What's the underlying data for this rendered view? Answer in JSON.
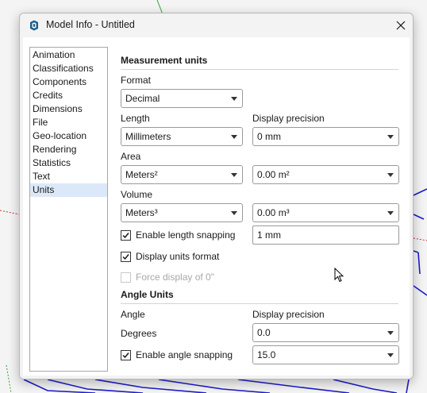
{
  "window": {
    "title": "Model Info - Untitled",
    "app_icon": "sketchup-icon",
    "close_icon": "close-icon"
  },
  "sidebar": {
    "items": [
      {
        "label": "Animation"
      },
      {
        "label": "Classifications"
      },
      {
        "label": "Components"
      },
      {
        "label": "Credits"
      },
      {
        "label": "Dimensions"
      },
      {
        "label": "File"
      },
      {
        "label": "Geo-location"
      },
      {
        "label": "Rendering"
      },
      {
        "label": "Statistics"
      },
      {
        "label": "Text"
      },
      {
        "label": "Units",
        "selected": true
      }
    ]
  },
  "units": {
    "measurement_heading": "Measurement units",
    "format_label": "Format",
    "format_value": "Decimal",
    "length_label": "Length",
    "length_value": "Millimeters",
    "display_precision_label": "Display precision",
    "length_precision": "0 mm",
    "area_label": "Area",
    "area_value": "Meters²",
    "area_precision": "0.00 m²",
    "volume_label": "Volume",
    "volume_value": "Meters³",
    "volume_precision": "0.00 m³",
    "length_snapping_label": "Enable length snapping",
    "length_snapping_checked": true,
    "length_snapping_value": "1 mm",
    "display_units_format_label": "Display units format",
    "display_units_format_checked": true,
    "force_display_label": "Force display of 0\"",
    "force_display_checked": false,
    "force_display_enabled": false,
    "angle_heading": "Angle Units",
    "angle_label": "Angle",
    "angle_precision_label": "Display precision",
    "angle_value": "Degrees",
    "angle_precision": "0.0",
    "angle_snapping_label": "Enable angle snapping",
    "angle_snapping_checked": true,
    "angle_snapping_value": "15.0"
  },
  "colors": {
    "accent_selection": "#dbe8f8",
    "background_lines": "#1a1acc",
    "disabled_text": "#a8a8a8"
  }
}
